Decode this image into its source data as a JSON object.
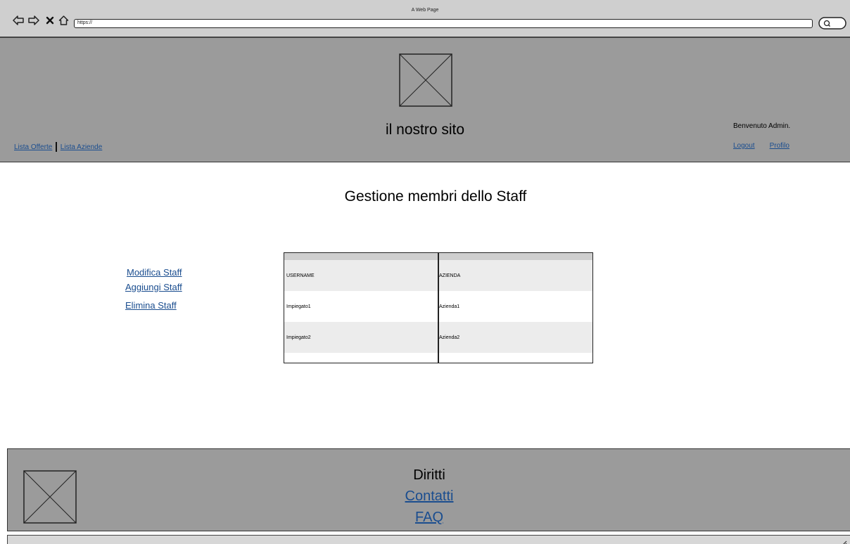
{
  "browser": {
    "window_title": "A Web Page",
    "address": "https://",
    "icons": [
      "back-icon",
      "forward-icon",
      "close-icon",
      "home-icon",
      "search-icon"
    ]
  },
  "header": {
    "site_title": "il nostro sito",
    "nav": {
      "lista_offerte": "Lista Offerte",
      "lista_aziende": "Lista Aziende"
    },
    "welcome": "Benvenuto Admin.",
    "user_links": {
      "logout": "Logout",
      "profilo": "Profilo"
    }
  },
  "main": {
    "heading": "Gestione membri dello Staff",
    "menu": {
      "modifica": "Modifica Staff",
      "aggiungi": "Aggiungi Staff",
      "elimina": "Elimina Staff"
    },
    "table": {
      "columns": [
        "USERNAME",
        "AZIENDA"
      ],
      "rows": [
        [
          "Impiegato1",
          "Azienda1"
        ],
        [
          "Impiegato2",
          "Azienda2"
        ]
      ]
    }
  },
  "footer": {
    "diritti": "Diritti",
    "contatti": "Contatti",
    "faq": "FAQ"
  },
  "colors": {
    "header_bg": "#9b9b9b",
    "chrome_bg": "#cfcfcf",
    "link": "#1a4d8f",
    "row_shade": "#ececec"
  }
}
